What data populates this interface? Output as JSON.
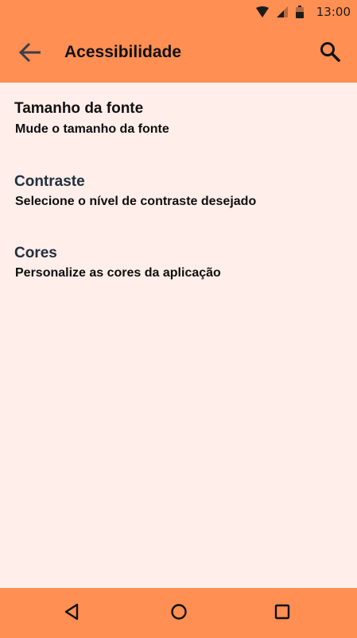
{
  "status_bar": {
    "time": "13:00",
    "icons": [
      "wifi-icon",
      "cell-signal-icon",
      "battery-icon"
    ]
  },
  "app_bar": {
    "title": "Acessibilidade",
    "back_icon": "arrow-back-icon",
    "search_icon": "search-icon"
  },
  "settings": [
    {
      "title": "Tamanho da fonte",
      "subtitle": "Mude o tamanho da fonte"
    },
    {
      "title": "Contraste",
      "subtitle": "Selecione o nível de contraste desejado"
    },
    {
      "title": "Cores",
      "subtitle": "Personalize as cores da aplicação"
    }
  ],
  "nav_bar": {
    "buttons": [
      "back-triangle-icon",
      "home-circle-icon",
      "recents-square-icon"
    ]
  },
  "colors": {
    "accent": "#FF8F52",
    "background": "#FFEEEA",
    "title_dark": "#111111",
    "title_slate": "#22303F"
  }
}
